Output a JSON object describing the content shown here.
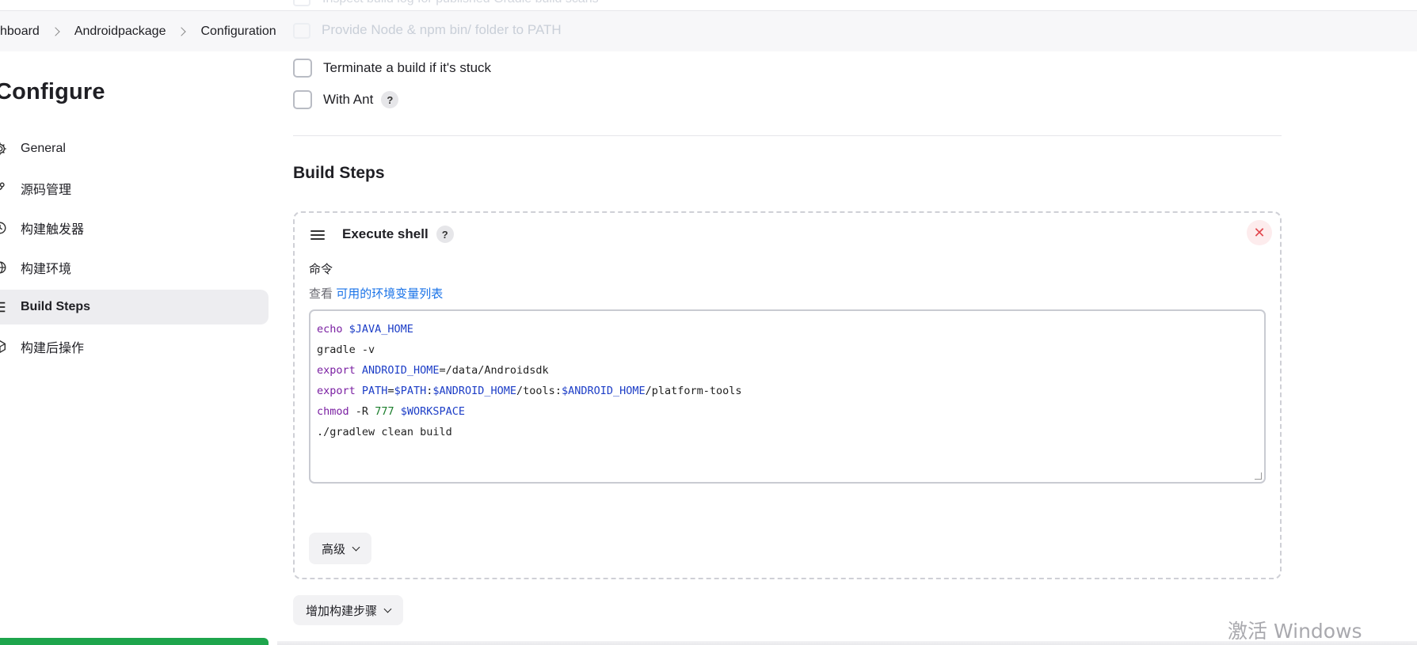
{
  "breadcrumb": {
    "items": [
      "shboard",
      "Androidpackage",
      "Configuration"
    ]
  },
  "ghost": {
    "top_text": "Inspect build log for published Gradle build scans",
    "node_text": "Provide Node & npm bin/ folder to PATH"
  },
  "page": {
    "title": "Configure"
  },
  "sidebar": {
    "items": [
      {
        "label": "General",
        "icon": "gear-icon",
        "active": false
      },
      {
        "label": "源码管理",
        "icon": "branch-icon",
        "active": false
      },
      {
        "label": "构建触发器",
        "icon": "clock-icon",
        "active": false
      },
      {
        "label": "构建环境",
        "icon": "globe-icon",
        "active": false
      },
      {
        "label": "Build Steps",
        "icon": "list-icon",
        "active": true
      },
      {
        "label": "构建后操作",
        "icon": "cube-icon",
        "active": false
      }
    ]
  },
  "options": {
    "terminate_label": "Terminate a build if it's stuck",
    "ant_label": "With Ant",
    "help_glyph": "?"
  },
  "build_steps": {
    "title": "Build Steps",
    "step_title": "Execute shell",
    "command_label": "命令",
    "env_prefix": "查看",
    "env_link": "可用的环境变量列表",
    "close_glyph": "✕",
    "code_lines": [
      "echo $JAVA_HOME",
      "gradle -v",
      "export ANDROID_HOME=/data/Androidsdk",
      "export PATH=$PATH:$ANDROID_HOME/tools:$ANDROID_HOME/platform-tools",
      "chmod -R 777 $WORKSPACE",
      "./gradlew clean build"
    ],
    "advanced_label": "高级",
    "add_step_label": "增加构建步骤"
  },
  "watermark": "激活 Windows",
  "colors": {
    "accent_link": "#1a73e8",
    "close_red": "#e2484f",
    "green_bar": "#1ea54c"
  }
}
